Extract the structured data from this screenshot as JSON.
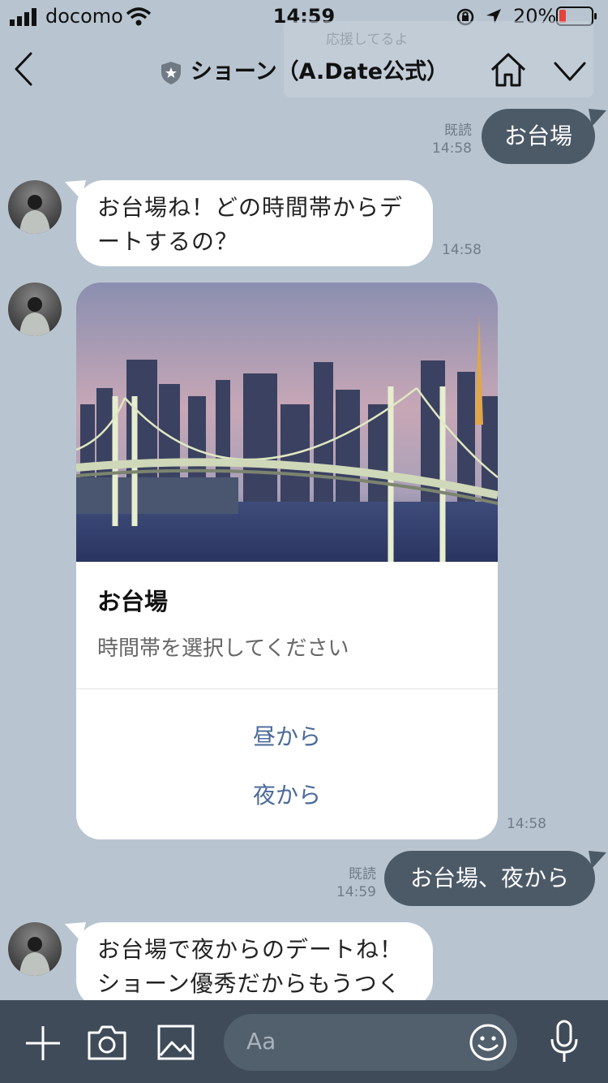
{
  "status_bar": {
    "carrier": "docomo",
    "time": "14:59",
    "battery": "20%"
  },
  "nav": {
    "title": "ショーン（A.Date公式）",
    "faded_banner": "応援してるよ"
  },
  "messages": {
    "out1": {
      "text": "お台場",
      "read": "既読",
      "time": "14:58"
    },
    "in1": {
      "line1": "お台場ね！どの時間帯からデ",
      "line2": "ートするの？",
      "time": "14:58"
    },
    "card": {
      "title": "お台場",
      "subtitle": "時間帯を選択してください",
      "buttons": [
        "昼から",
        "夜から"
      ],
      "time": "14:58"
    },
    "out2": {
      "text": "お台場、夜から",
      "read": "既読",
      "time": "14:59"
    },
    "in2": {
      "line1": "お台場で夜からのデートね！",
      "line2": "ショーン優秀だからもうつく"
    }
  },
  "input": {
    "placeholder": "Aa"
  },
  "colors": {
    "chat_bg": "#b8c5d0",
    "bubble_out": "#4c5a68",
    "bubble_in": "#ffffff",
    "link": "#4b6a9b",
    "bottom_bar": "#3f4b58",
    "battery_low": "#e5443a"
  },
  "icons": [
    "signal-icon",
    "wifi-icon",
    "orientation-lock-icon",
    "location-icon",
    "battery-icon",
    "back-icon",
    "shield-icon",
    "home-icon",
    "chevron-down-icon",
    "plus-icon",
    "camera-icon",
    "image-icon",
    "emoji-icon",
    "mic-icon"
  ]
}
